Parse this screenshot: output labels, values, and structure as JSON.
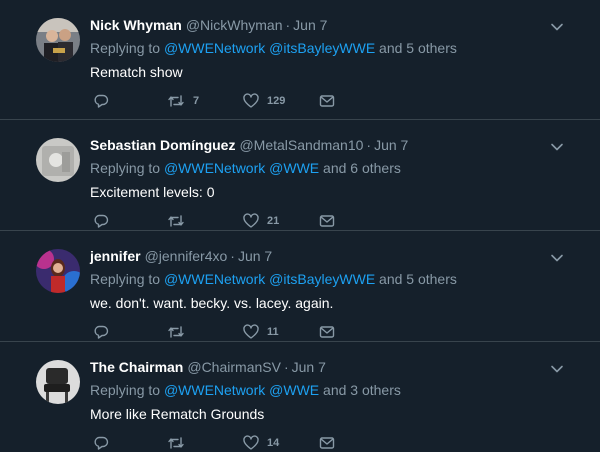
{
  "tweets": [
    {
      "name": "Nick Whyman",
      "handle": "@NickWhyman",
      "date": "Jun 7",
      "replying_prefix": "Replying to",
      "mentions": [
        "@WWENetwork",
        "@itsBayleyWWE"
      ],
      "others": "and 5 others",
      "text": "Rematch show",
      "replies": "",
      "retweets": "7",
      "likes": "129"
    },
    {
      "name": "Sebastian Domínguez",
      "handle": "@MetalSandman10",
      "date": "Jun 7",
      "replying_prefix": "Replying to",
      "mentions": [
        "@WWENetwork",
        "@WWE"
      ],
      "others": "and 6 others",
      "text": "Excitement levels: 0",
      "replies": "",
      "retweets": "",
      "likes": "21"
    },
    {
      "name": "jennifer",
      "handle": "@jennifer4xo",
      "date": "Jun 7",
      "replying_prefix": "Replying to",
      "mentions": [
        "@WWENetwork",
        "@itsBayleyWWE"
      ],
      "others": "and 5 others",
      "text": "we. don't. want. becky. vs. lacey. again.",
      "replies": "",
      "retweets": "",
      "likes": "11"
    },
    {
      "name": "The Chairman",
      "handle": "@ChairmanSV",
      "date": "Jun 7",
      "replying_prefix": "Replying to",
      "mentions": [
        "@WWENetwork",
        "@WWE"
      ],
      "others": "and 3 others",
      "text": "More like Rematch Grounds",
      "replies": "",
      "retweets": "",
      "likes": "14"
    }
  ],
  "dot_separator": "·",
  "icons": {
    "reply": "reply-icon",
    "retweet": "retweet-icon",
    "like": "heart-icon",
    "dm": "envelope-icon",
    "more": "chevron-down-icon"
  },
  "colors": {
    "background": "#15202b",
    "divider": "#38444d",
    "secondary_text": "#8899a6",
    "link": "#1da1f2",
    "primary_text": "#ffffff"
  }
}
